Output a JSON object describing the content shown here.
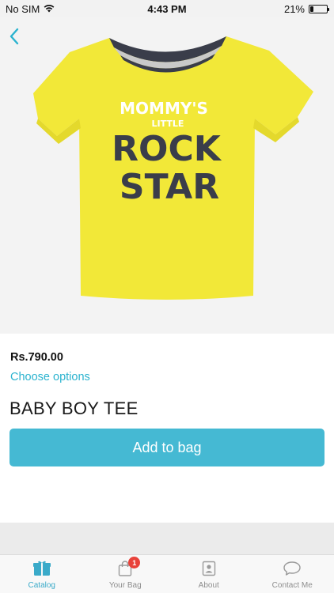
{
  "status_bar": {
    "carrier": "No SIM",
    "time": "4:43 PM",
    "battery_percent": "21%",
    "battery_level": 0.21
  },
  "product": {
    "image_icon": "t-shirt-image",
    "shirt_color": "#f2e838",
    "collar_color": "#3a3d4a",
    "print_line1": "MOMMY'S",
    "print_line2": "LITTLE",
    "print_line3": "ROCK",
    "print_line4": "STAR",
    "price": "Rs.790.00",
    "choose_options": "Choose options",
    "title": "BABY BOY TEE",
    "add_to_bag": "Add to bag"
  },
  "tab_bar": {
    "tabs": [
      {
        "label": "Catalog",
        "icon": "catalog-icon",
        "active": true
      },
      {
        "label": "Your Bag",
        "icon": "bag-icon",
        "badge": "1"
      },
      {
        "label": "About",
        "icon": "about-icon"
      },
      {
        "label": "Contact Me",
        "icon": "chat-icon"
      }
    ]
  },
  "colors": {
    "accent": "#45b9d3",
    "link": "#2bb3cf",
    "badge": "#e8423a"
  }
}
